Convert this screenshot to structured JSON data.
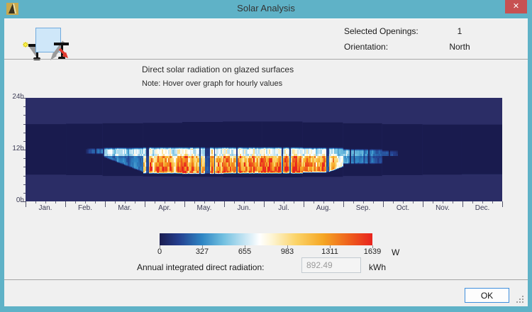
{
  "win": {
    "title": "Solar Analysis",
    "close_glyph": "✕"
  },
  "header": {
    "selected_openings_label": "Selected Openings:",
    "selected_openings_value": "1",
    "orientation_label": "Orientation:",
    "orientation_value": "North"
  },
  "toolbar": {
    "buttons": [
      {
        "name": "show-sun-on-opening",
        "selected": false
      },
      {
        "name": "solar-radiation-analysis",
        "selected": true
      }
    ]
  },
  "chart": {
    "title": "Direct solar radiation on glazed surfaces",
    "note": "Note: Hover over graph for hourly values"
  },
  "chart_data": {
    "type": "heatmap",
    "title": "Direct solar radiation on glazed surfaces",
    "x_unit": "day of year",
    "y_unit": "hour of day",
    "y_range": [
      0,
      24
    ],
    "y_tick_labels": [
      "24h",
      "12h",
      "0h"
    ],
    "x_tick_labels": [
      "Jan.",
      "Feb.",
      "Mar.",
      "Apr.",
      "May.",
      "Jun.",
      "Jul.",
      "Aug.",
      "Sep.",
      "Oct.",
      "Nov.",
      "Dec."
    ],
    "days_per_month": [
      31,
      28,
      31,
      30,
      31,
      30,
      31,
      31,
      30,
      31,
      30,
      31
    ],
    "colorbar": {
      "ticks": [
        0,
        327,
        655,
        983,
        1311,
        1639
      ],
      "unit": "W",
      "max_w": 1639,
      "stops": [
        {
          "t": 0.0,
          "color": "#1b1d50"
        },
        {
          "t": 0.09,
          "color": "#243e8e"
        },
        {
          "t": 0.2,
          "color": "#2f86c4"
        },
        {
          "t": 0.3,
          "color": "#72c0e0"
        },
        {
          "t": 0.4,
          "color": "#c6e5f3"
        },
        {
          "t": 0.47,
          "color": "#ffffff"
        },
        {
          "t": 0.53,
          "color": "#fdf4d2"
        },
        {
          "t": 0.64,
          "color": "#fbd469"
        },
        {
          "t": 0.77,
          "color": "#f5a623"
        },
        {
          "t": 0.9,
          "color": "#ee5a1c"
        },
        {
          "t": 1.0,
          "color": "#e8231e"
        }
      ]
    },
    "background": {
      "outer": "#2b2d66",
      "day_band": "#191b4e",
      "day_band_top_hour": [
        17.9,
        18.0,
        18.1,
        18.2,
        18.4,
        18.5,
        18.5,
        18.3,
        18.1,
        17.9,
        17.8,
        17.8
      ],
      "day_band_bottom_hour": [
        6.2,
        6.1,
        5.9,
        5.8,
        5.7,
        5.6,
        5.6,
        5.7,
        5.9,
        6.1,
        6.2,
        6.3
      ]
    },
    "split_hour": 10.6,
    "months": [
      {
        "label": "Jan.",
        "active": false
      },
      {
        "label": "Feb.",
        "active": true,
        "start_frac": 0.5,
        "top_h": 12.4,
        "bot_h": 10.9,
        "upper_w": 380,
        "lower_w": 0
      },
      {
        "label": "Mar.",
        "active": true,
        "top_h": 12.5,
        "bot_h_start": 10.2,
        "bot_h_end": 6.6,
        "bot_h": 6.6,
        "upper_w": 680,
        "lower_w": 300
      },
      {
        "label": "Apr.",
        "active": true,
        "top_h": 12.6,
        "bot_h": 6.4,
        "upper_w": 860,
        "lower_w": 1430
      },
      {
        "label": "May.",
        "active": true,
        "top_h": 12.6,
        "bot_h": 6.3,
        "upper_w": 900,
        "lower_w": 1500
      },
      {
        "label": "Jun.",
        "active": true,
        "top_h": 12.6,
        "bot_h": 6.4,
        "upper_w": 880,
        "lower_w": 1520
      },
      {
        "label": "Jul.",
        "active": true,
        "top_h": 12.6,
        "bot_h": 6.4,
        "upper_w": 900,
        "lower_w": 1560
      },
      {
        "label": "Aug.",
        "active": true,
        "top_h": 12.5,
        "bot_h": 6.6,
        "upper_w": 860,
        "lower_w": 1420,
        "fade_after": 0.6,
        "fade_to": 0.5,
        "bot_h_late": 8.0
      },
      {
        "label": "Sep.",
        "active": true,
        "top_h": 12.2,
        "bot_h": 8.6,
        "upper_w": 620,
        "lower_w": 430,
        "fade_lin": true,
        "fade_to": 0.45
      },
      {
        "label": "Oct.",
        "active": true,
        "end_frac": 0.4,
        "top_h": 11.9,
        "bot_h": 9.2,
        "upper_w": 320,
        "lower_w": 0,
        "fade_to": 0.3
      },
      {
        "label": "Nov.",
        "active": false
      },
      {
        "label": "Dec.",
        "active": false
      }
    ]
  },
  "annual": {
    "label": "Annual integrated direct radiation:",
    "value": "892.49",
    "unit": "kWh"
  },
  "footer": {
    "ok_label": "OK"
  }
}
